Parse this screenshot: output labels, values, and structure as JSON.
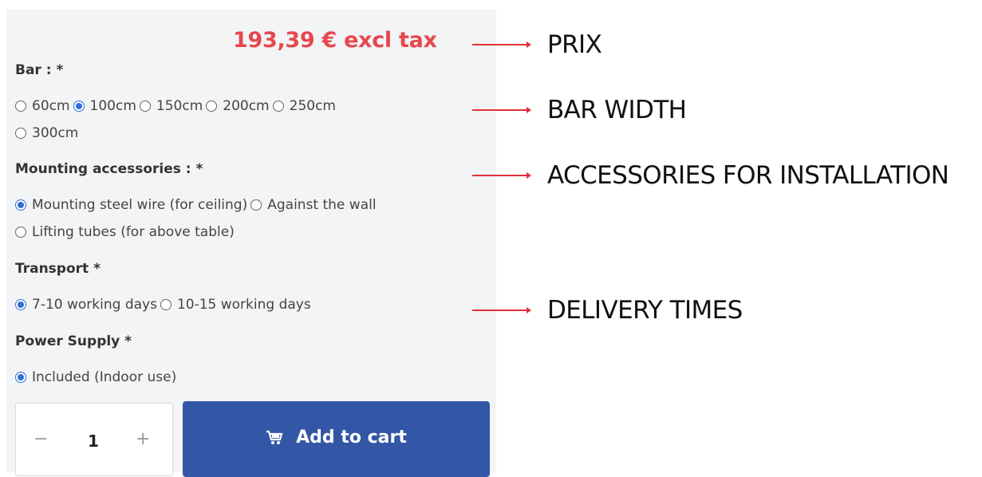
{
  "product": {
    "price": "193,39 € excl tax",
    "groups": [
      {
        "label": "Bar : *",
        "lines": [
          [
            {
              "label": "60cm",
              "checked": false
            },
            {
              "label": "100cm",
              "checked": true
            },
            {
              "label": "150cm",
              "checked": false
            },
            {
              "label": "200cm",
              "checked": false
            },
            {
              "label": "250cm",
              "checked": false
            }
          ],
          [
            {
              "label": "300cm",
              "checked": false
            }
          ]
        ]
      },
      {
        "label": "Mounting accessories : *",
        "lines": [
          [
            {
              "label": "Mounting steel wire (for ceiling)",
              "checked": true
            },
            {
              "label": "Against the wall",
              "checked": false
            }
          ],
          [
            {
              "label": "Lifting tubes (for above table)",
              "checked": false
            }
          ]
        ]
      },
      {
        "label": "Transport *",
        "lines": [
          [
            {
              "label": "7-10 working days",
              "checked": true
            },
            {
              "label": "10-15 working days",
              "checked": false
            }
          ]
        ]
      },
      {
        "label": "Power Supply *",
        "lines": [
          [
            {
              "label": "Included (Indoor use)",
              "checked": true
            }
          ]
        ]
      }
    ],
    "quantity": {
      "minus": "−",
      "value": "1",
      "plus": "+"
    },
    "add_to_cart": {
      "label": "Add to cart",
      "icon": "cart-icon"
    }
  },
  "annotations": [
    {
      "label": "PRIX",
      "color": "#e0313a"
    },
    {
      "label": "BAR WIDTH",
      "color": "#e0313a"
    },
    {
      "label": "ACCESSORIES FOR INSTALLATION",
      "color": "#e0313a"
    },
    {
      "label": "DELIVERY TIMES",
      "color": "#e0313a"
    }
  ]
}
